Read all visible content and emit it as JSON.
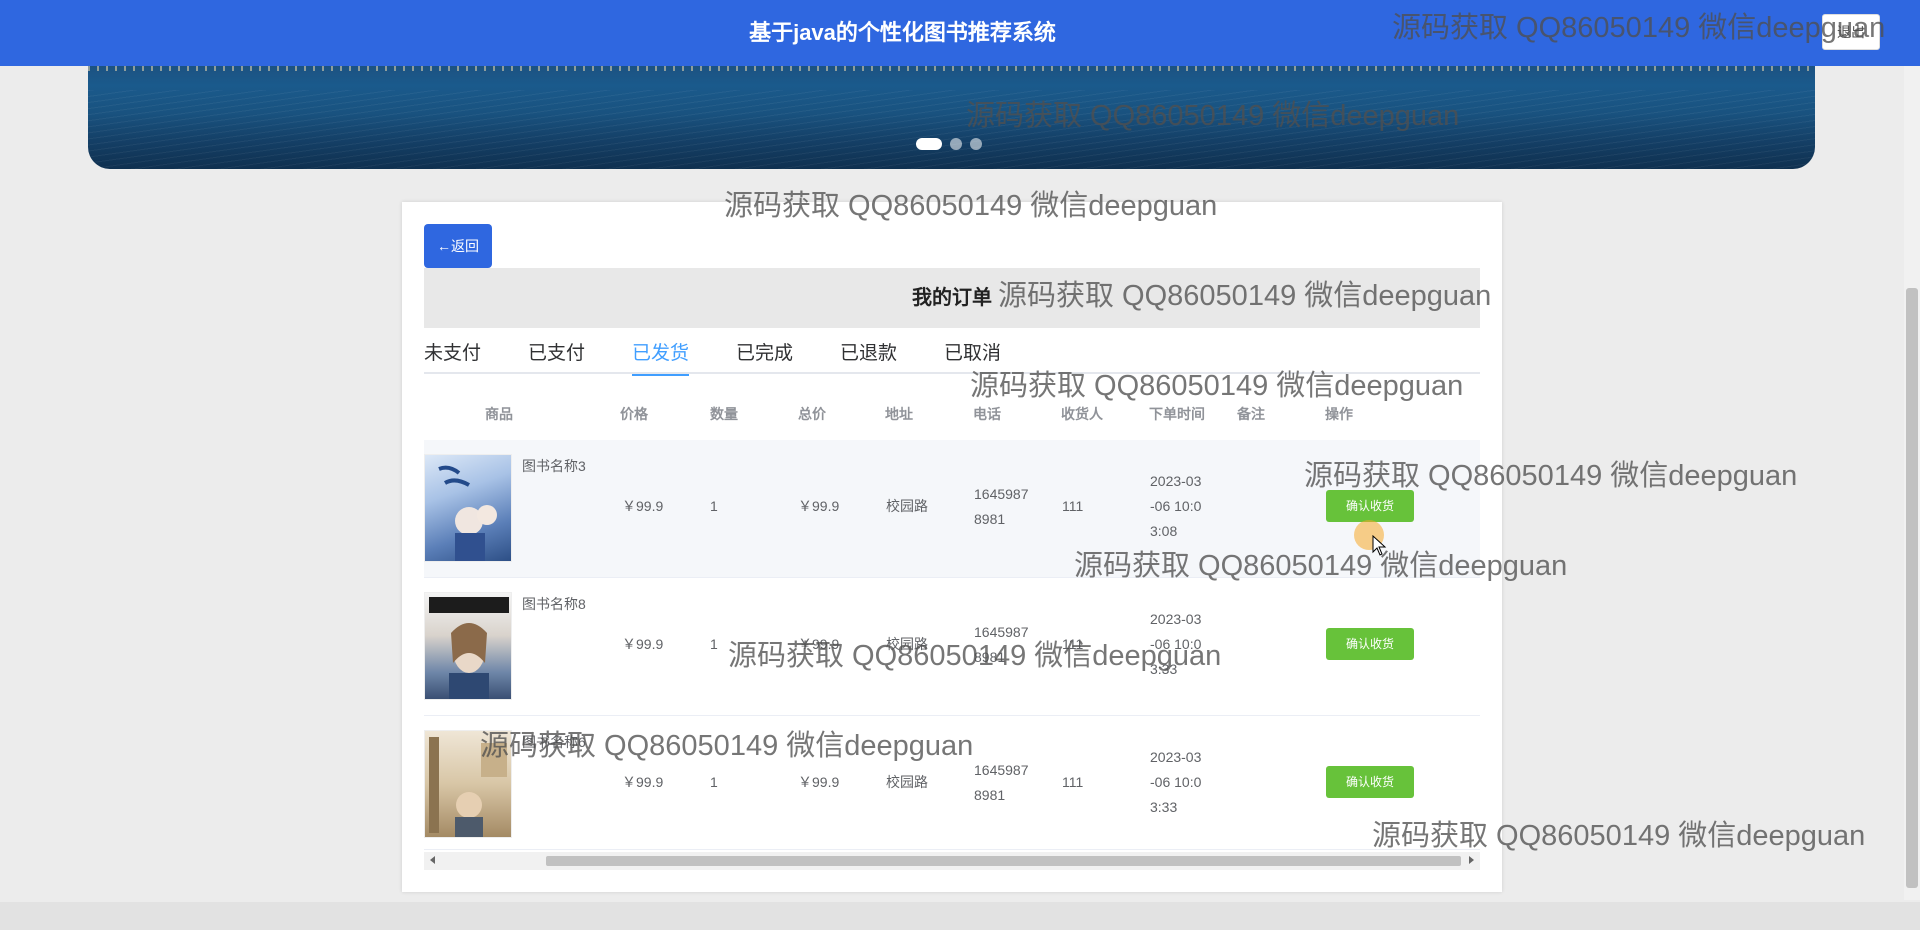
{
  "header": {
    "title": "基于java的个性化图书推荐系统",
    "logout_label": "退出"
  },
  "back_label": "←返回",
  "page_title": "我的订单",
  "tabs": [
    "未支付",
    "已支付",
    "已发货",
    "已完成",
    "已退款",
    "已取消"
  ],
  "active_tab": "已发货",
  "columns": [
    "商品",
    "价格",
    "数量",
    "总价",
    "地址",
    "电话",
    "收货人",
    "下单时间",
    "备注",
    "操作"
  ],
  "orders": [
    {
      "name": "图书名称3",
      "price": "￥99.9",
      "qty": "1",
      "total": "￥99.9",
      "address": "校园路",
      "phone_a": "1645987",
      "phone_b": "8981",
      "receiver": "111",
      "time_a": "2023-03",
      "time_b": "-06 10:0",
      "time_c": "3:08",
      "note": "",
      "action": "确认收货"
    },
    {
      "name": "图书名称8",
      "price": "￥99.9",
      "qty": "1",
      "total": "￥99.9",
      "address": "校园路",
      "phone_a": "1645987",
      "phone_b": "8981",
      "receiver": "111",
      "time_a": "2023-03",
      "time_b": "-06 10:0",
      "time_c": "3:33",
      "note": "",
      "action": "确认收货"
    },
    {
      "name": "图书名称6",
      "price": "￥99.9",
      "qty": "1",
      "total": "￥99.9",
      "address": "校园路",
      "phone_a": "1645987",
      "phone_b": "8981",
      "receiver": "111",
      "time_a": "2023-03",
      "time_b": "-06 10:0",
      "time_c": "3:33",
      "note": "",
      "action": "确认收货"
    }
  ],
  "watermark": "源码获取 QQ86050149 微信deepguan"
}
